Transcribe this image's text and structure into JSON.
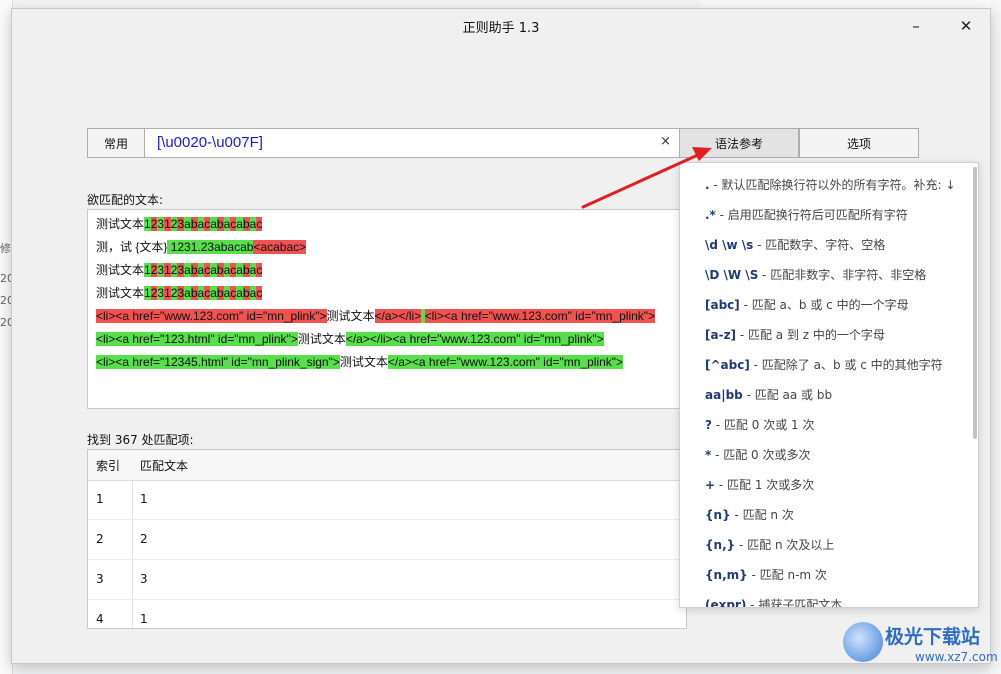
{
  "window": {
    "title": "正则助手 1.3"
  },
  "controls": {
    "minimize": "–",
    "close": "✕",
    "common_button": "常用",
    "regex_value": "[\\u0020-\\u007F]",
    "clear_button": "×",
    "syntax_ref_button": "语法参考",
    "options_button": "选项"
  },
  "match_text": {
    "label": "欲匹配的文本:",
    "lines": [
      [
        [
          "w",
          "测试文本"
        ],
        [
          "g",
          "1"
        ],
        [
          "r",
          "2"
        ],
        [
          "g",
          "3"
        ],
        [
          "r",
          "1"
        ],
        [
          "g",
          "2"
        ],
        [
          "r",
          "3"
        ],
        [
          "g",
          "a"
        ],
        [
          "r",
          "b"
        ],
        [
          "g",
          "a"
        ],
        [
          "r",
          "c"
        ],
        [
          "g",
          "a"
        ],
        [
          "r",
          "b"
        ],
        [
          "g",
          "a"
        ],
        [
          "r",
          "c"
        ],
        [
          "g",
          "a"
        ],
        [
          "r",
          "b"
        ],
        [
          "g",
          "a"
        ],
        [
          "r",
          "c"
        ]
      ],
      [
        [
          "w",
          "测，试 {文本}"
        ],
        [
          "g",
          " 1231.23abacab"
        ],
        [
          "r",
          "<acabac>"
        ]
      ],
      [
        [
          "w",
          "测试文本"
        ],
        [
          "g",
          "1"
        ],
        [
          "r",
          "2"
        ],
        [
          "g",
          "3"
        ],
        [
          "r",
          "1"
        ],
        [
          "g",
          "2"
        ],
        [
          "r",
          "3"
        ],
        [
          "g",
          "a"
        ],
        [
          "r",
          "b"
        ],
        [
          "g",
          "a"
        ],
        [
          "r",
          "c"
        ],
        [
          "g",
          "a"
        ],
        [
          "r",
          "b"
        ],
        [
          "g",
          "a"
        ],
        [
          "r",
          "c"
        ],
        [
          "g",
          "a"
        ],
        [
          "r",
          "b"
        ],
        [
          "g",
          "a"
        ],
        [
          "r",
          "c"
        ]
      ],
      [
        [
          "w",
          "测试文本"
        ],
        [
          "g",
          "1"
        ],
        [
          "r",
          "2"
        ],
        [
          "g",
          "3"
        ],
        [
          "r",
          "1"
        ],
        [
          "g",
          "2"
        ],
        [
          "r",
          "3"
        ],
        [
          "g",
          "a"
        ],
        [
          "r",
          "b"
        ],
        [
          "g",
          "a"
        ],
        [
          "r",
          "c"
        ],
        [
          "g",
          "a"
        ],
        [
          "r",
          "b"
        ],
        [
          "g",
          "a"
        ],
        [
          "r",
          "c"
        ],
        [
          "g",
          "a"
        ],
        [
          "r",
          "b"
        ],
        [
          "g",
          "a"
        ],
        [
          "r",
          "c"
        ]
      ],
      [
        [
          "r",
          "<li><a href=\"www.123.com\" id=\"mn_plink\">"
        ],
        [
          "w",
          "测试文本"
        ],
        [
          "r",
          "</a></li>"
        ],
        [
          "g",
          "    "
        ],
        [
          "r",
          "<li><a href=\"www.123.com\" id=\"mn_plink\">"
        ]
      ],
      [
        [
          "g",
          " <li><a href=\"123.html\" id=\"mn_plink\">"
        ],
        [
          "w",
          "测试文本"
        ],
        [
          "g",
          "</a></li><a href=\"www.123.com\" id=\"mn_plink\">"
        ]
      ],
      [
        [
          "g",
          "  <li><a href=\"12345.html\" id=\"mn_plink_sign\">"
        ],
        [
          "w",
          "测试文本"
        ],
        [
          "g",
          "</a><a href=\"www.123.com\" id=\"mn_plink\">"
        ]
      ]
    ]
  },
  "results": {
    "label": "找到 367 处匹配项:",
    "columns": [
      "索引",
      "匹配文本"
    ],
    "rows": [
      [
        "1",
        "1"
      ],
      [
        "2",
        "2"
      ],
      [
        "3",
        "3"
      ],
      [
        "4",
        "1"
      ]
    ]
  },
  "syntax_menu": [
    {
      "k": ".",
      "d": " - 默认匹配除换行符以外的所有字符。补充: ↓"
    },
    {
      "k": ".*",
      "d": " - 启用匹配换行符后可匹配所有字符"
    },
    {
      "k": "\\d  \\w  \\s",
      "d": " - 匹配数字、字符、空格"
    },
    {
      "k": "\\D  \\W  \\S",
      "d": " - 匹配非数字、非字符、非空格"
    },
    {
      "k": "[abc]",
      "d": " - 匹配 a、b 或 c 中的一个字母"
    },
    {
      "k": "[a-z]",
      "d": " - 匹配 a 到 z 中的一个字母"
    },
    {
      "k": "[^abc]",
      "d": " - 匹配除了 a、b 或 c 中的其他字符"
    },
    {
      "k": "aa|bb",
      "d": " - 匹配 aa 或 bb"
    },
    {
      "k": "?",
      "d": " - 匹配 0 次或 1 次"
    },
    {
      "k": "*",
      "d": " - 匹配 0 次或多次"
    },
    {
      "k": "+",
      "d": " - 匹配 1 次或多次"
    },
    {
      "k": "{n}",
      "d": " - 匹配 n 次"
    },
    {
      "k": "{n,}",
      "d": " - 匹配 n 次及以上"
    },
    {
      "k": "{n,m}",
      "d": " - 匹配 n-m 次"
    },
    {
      "k": "(expr)",
      "d": " - 捕获子匹配文本"
    }
  ],
  "watermark": {
    "title": "极光下载站",
    "url": "www.xz7.com"
  },
  "background": {
    "left_snippets": [
      "修",
      "20",
      "20",
      "20"
    ]
  }
}
